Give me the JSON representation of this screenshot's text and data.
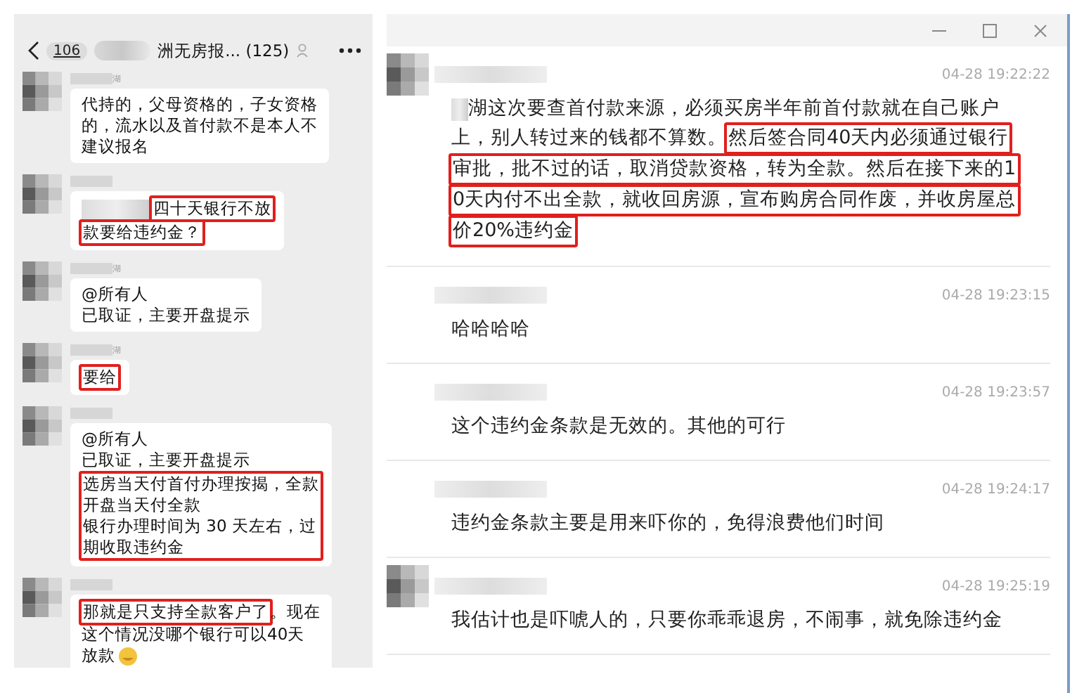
{
  "left_chat": {
    "unread_badge": "106",
    "title": "洲无房报... (125)",
    "messages": [
      {
        "sender_suffix": "湖",
        "lines": [
          [
            {
              "kind": "text",
              "text": "代持的，父母资格的，子女资格",
              "highlighted": false
            }
          ],
          [
            {
              "kind": "text",
              "text": "的，流水以及首付款不是本人不",
              "highlighted": false
            }
          ],
          [
            {
              "kind": "text",
              "text": "建议报名",
              "highlighted": false
            }
          ]
        ]
      },
      {
        "lines": [
          [
            {
              "kind": "blur"
            },
            {
              "kind": "text",
              "text": "四十天银行不放",
              "highlighted": true
            }
          ],
          [
            {
              "kind": "text",
              "text": "款要给违约金？",
              "highlighted": true
            }
          ]
        ]
      },
      {
        "sender_suffix": "湖",
        "lines": [
          [
            {
              "kind": "text",
              "text": "@所有人",
              "highlighted": false
            }
          ],
          [
            {
              "kind": "text",
              "text": "已取证，主要开盘提示",
              "highlighted": false
            }
          ]
        ]
      },
      {
        "sender_suffix": "湖",
        "lines": [
          [
            {
              "kind": "text",
              "text": "要给",
              "highlighted": true
            }
          ]
        ]
      },
      {
        "lines": [
          [
            {
              "kind": "text",
              "text": "@所有人",
              "highlighted": false
            }
          ],
          [
            {
              "kind": "text",
              "text": "已取证，主要开盘提示",
              "highlighted": false
            }
          ],
          [
            {
              "kind": "block",
              "texts": [
                "选房当天付首付办理按揭，全款",
                "开盘当天付全款",
                "银行办理时间为 30 天左右，过",
                "期收取违约金"
              ],
              "highlighted": true
            }
          ]
        ]
      },
      {
        "lines": [
          [
            {
              "kind": "text",
              "text": "那就是只支持全款客户了",
              "highlighted": true
            },
            {
              "kind": "text",
              "text": "。现在",
              "highlighted": false
            }
          ],
          [
            {
              "kind": "text",
              "text": "这个情况没哪个银行可以40天",
              "highlighted": false
            }
          ],
          [
            {
              "kind": "text",
              "text": "放款",
              "highlighted": false
            },
            {
              "kind": "emoji"
            }
          ]
        ]
      }
    ]
  },
  "right_window": {
    "messages": [
      {
        "show_avatar": true,
        "time": "04-28 19:22:22",
        "lines": [
          [
            {
              "kind": "blur"
            },
            {
              "kind": "text",
              "text": "湖这次要查首付款来源，必须买房半年前首付款就在自己账户",
              "highlighted": false
            }
          ],
          [
            {
              "kind": "text",
              "text": "上，别人转过来的钱都不算数。",
              "highlighted": false
            },
            {
              "kind": "text",
              "text": "然后签合同40天内必须通过银行",
              "highlighted": true
            }
          ],
          [
            {
              "kind": "text",
              "text": "审批，批不过的话，取消贷款资格，转为全款。然后在接下来的1",
              "highlighted": true
            }
          ],
          [
            {
              "kind": "text",
              "text": "0天内付不出全款，就收回房源，宣布购房合同作废，并收房屋总",
              "highlighted": true
            }
          ],
          [
            {
              "kind": "text",
              "text": "价20%违约金",
              "highlighted": true
            }
          ]
        ]
      },
      {
        "show_avatar": false,
        "time": "04-28 19:23:15",
        "lines": [
          [
            {
              "kind": "text",
              "text": "哈哈哈哈",
              "highlighted": false
            }
          ]
        ]
      },
      {
        "show_avatar": false,
        "time": "04-28 19:23:57",
        "lines": [
          [
            {
              "kind": "text",
              "text": "这个违约金条款是无效的。其他的可行",
              "highlighted": false
            }
          ]
        ]
      },
      {
        "show_avatar": false,
        "time": "04-28 19:24:17",
        "lines": [
          [
            {
              "kind": "text",
              "text": "违约金条款主要是用来吓你的，免得浪费他们时间",
              "highlighted": false
            }
          ]
        ]
      },
      {
        "show_avatar": true,
        "time": "04-28 19:25:19",
        "lines": [
          [
            {
              "kind": "text",
              "text": "我估计也是吓唬人的，只要你乖乖退房，不闹事，就免除违约金",
              "highlighted": false
            }
          ]
        ]
      }
    ]
  }
}
